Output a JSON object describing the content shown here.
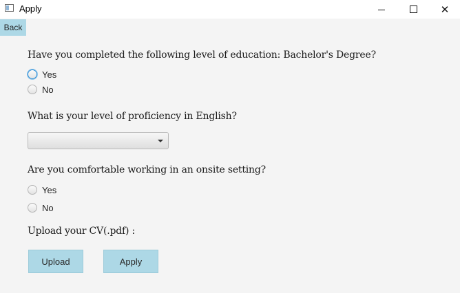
{
  "window": {
    "title": "Apply",
    "icon": "app-window-icon",
    "controls": {
      "minimize": "minimize-icon",
      "maximize": "maximize-icon",
      "close": "close-icon",
      "close_glyph": "✕"
    }
  },
  "nav": {
    "back_label": "Back"
  },
  "q1": {
    "question": "Have you completed the following level of education: Bachelor's Degree?",
    "options": [
      {
        "label": "Yes",
        "selected": false,
        "focused": true
      },
      {
        "label": "No",
        "selected": false,
        "focused": false
      }
    ]
  },
  "q2": {
    "question": "What is your level of proficiency in English?",
    "selected_value": ""
  },
  "q3": {
    "question": "Are you comfortable working in an onsite setting?",
    "options": [
      {
        "label": "Yes",
        "selected": false
      },
      {
        "label": "No",
        "selected": false
      }
    ]
  },
  "cv": {
    "label": "Upload your CV(.pdf) :"
  },
  "buttons": {
    "upload_label": "Upload",
    "apply_label": "Apply"
  },
  "colors": {
    "button_bg": "#add8e6",
    "background": "#f4f4f4",
    "focus_ring": "#2f8fd6"
  }
}
